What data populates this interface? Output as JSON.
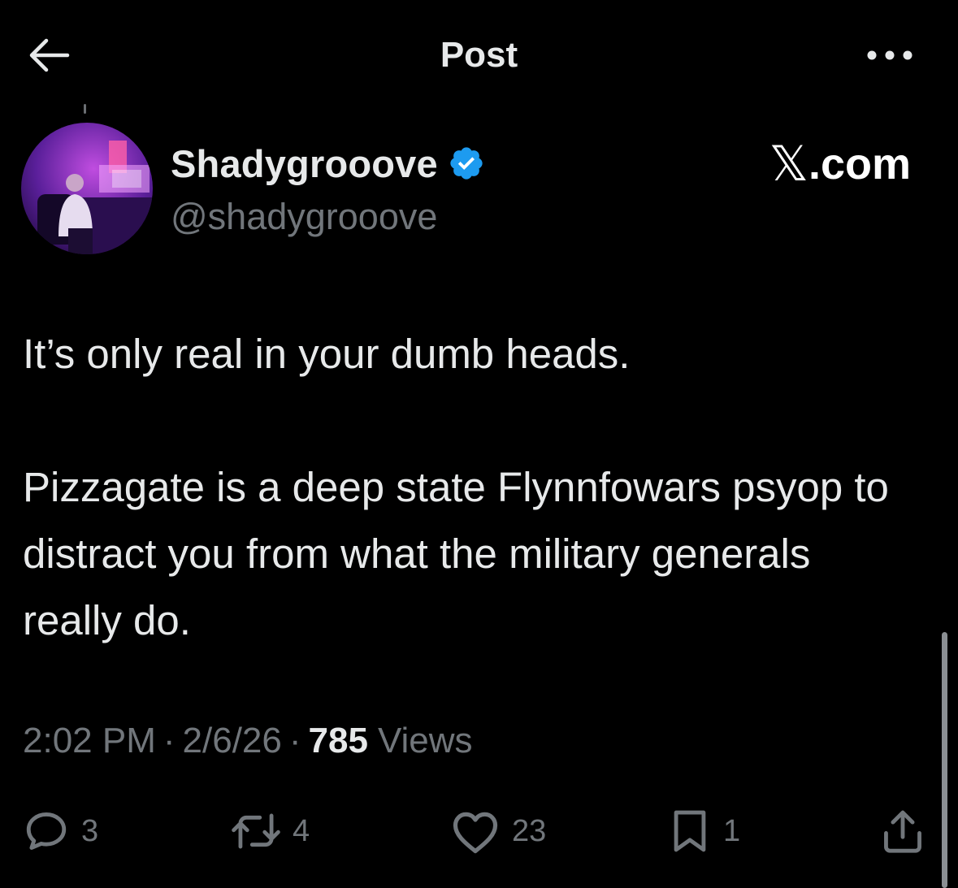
{
  "header": {
    "title": "Post",
    "back_icon": "arrow-left-icon",
    "more_icon": "more-horizontal-icon"
  },
  "author": {
    "display_name": "Shadygrooove",
    "handle": "@shadygrooove",
    "verified": true,
    "verified_color": "#1d9bf0"
  },
  "watermark": {
    "logo": "𝕏",
    "text": ".com"
  },
  "post": {
    "paragraphs": [
      "It’s only real in your dumb heads.",
      "Pizzagate is a deep state Flynnfowars psyop to distract you from what the military generals really do."
    ]
  },
  "meta": {
    "time": "2:02 PM",
    "separator": "·",
    "date": "2/6/26",
    "views_count": "785",
    "views_label": "Views"
  },
  "actions": {
    "replies": "3",
    "reposts": "4",
    "likes": "23",
    "bookmarks": "1"
  },
  "colors": {
    "background": "#000000",
    "text_primary": "#e7e9ea",
    "text_secondary": "#71767b"
  }
}
